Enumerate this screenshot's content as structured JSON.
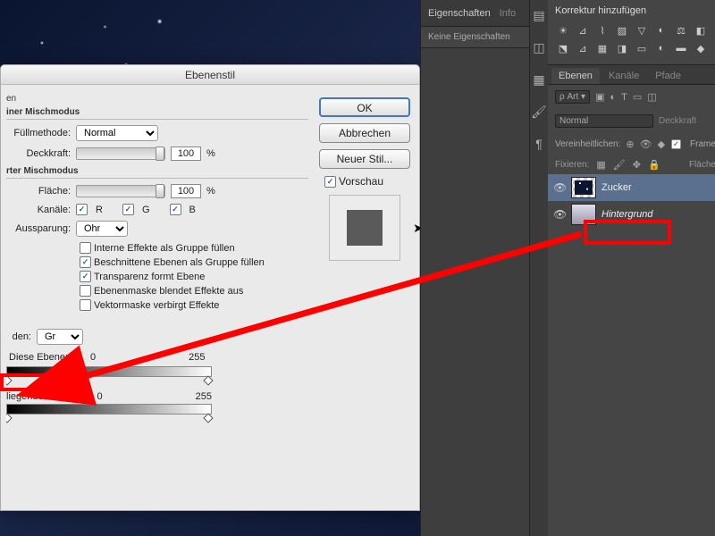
{
  "dialog": {
    "title": "Ebenenstil",
    "section1": "en",
    "section1b": "iner Mischmodus",
    "fill_label": "Füllmethode:",
    "fill_value": "Normal",
    "opacity_label": "Deckkraft:",
    "opacity_value": "100",
    "pct": "%",
    "section2": "rter Mischmodus",
    "area_label": "Fläche:",
    "area_value": "100",
    "channels_label": "Kanäle:",
    "ch_r": "R",
    "ch_g": "G",
    "ch_b": "B",
    "knockout_label": "Aussparung:",
    "knockout_value": "Ohne",
    "opt1": "Interne Effekte als Gruppe füllen",
    "opt2": "Beschnittene Ebenen als Gruppe füllen",
    "opt3": "Transparenz formt Ebene",
    "opt4": "Ebenenmaske blendet Effekte aus",
    "opt5": "Vektormaske verbirgt Effekte",
    "blend_label": "den:",
    "blend_value": "Grau",
    "this_layer": "Diese Ebene:",
    "this_lo": "0",
    "this_hi": "255",
    "under_layer": "liegende Ebene:",
    "under_lo": "0",
    "under_hi": "255",
    "ok": "OK",
    "cancel": "Abbrechen",
    "new_style": "Neuer Stil...",
    "preview": "Vorschau"
  },
  "props": {
    "tab1": "Eigenschaften",
    "tab2": "Info",
    "none": "Keine Eigenschaften"
  },
  "adjust": {
    "title": "Korrektur hinzufügen"
  },
  "layers": {
    "tab1": "Ebenen",
    "tab2": "Kanäle",
    "tab3": "Pfade",
    "kind": "Art",
    "blend": "Normal",
    "opacity_label": "Deckkraft",
    "unify": "Vereinheitlichen:",
    "frame": "Frame",
    "lock": "Fixieren:",
    "fill": "Fläche",
    "layer1": "Zucker",
    "layer2": "Hintergrund"
  }
}
